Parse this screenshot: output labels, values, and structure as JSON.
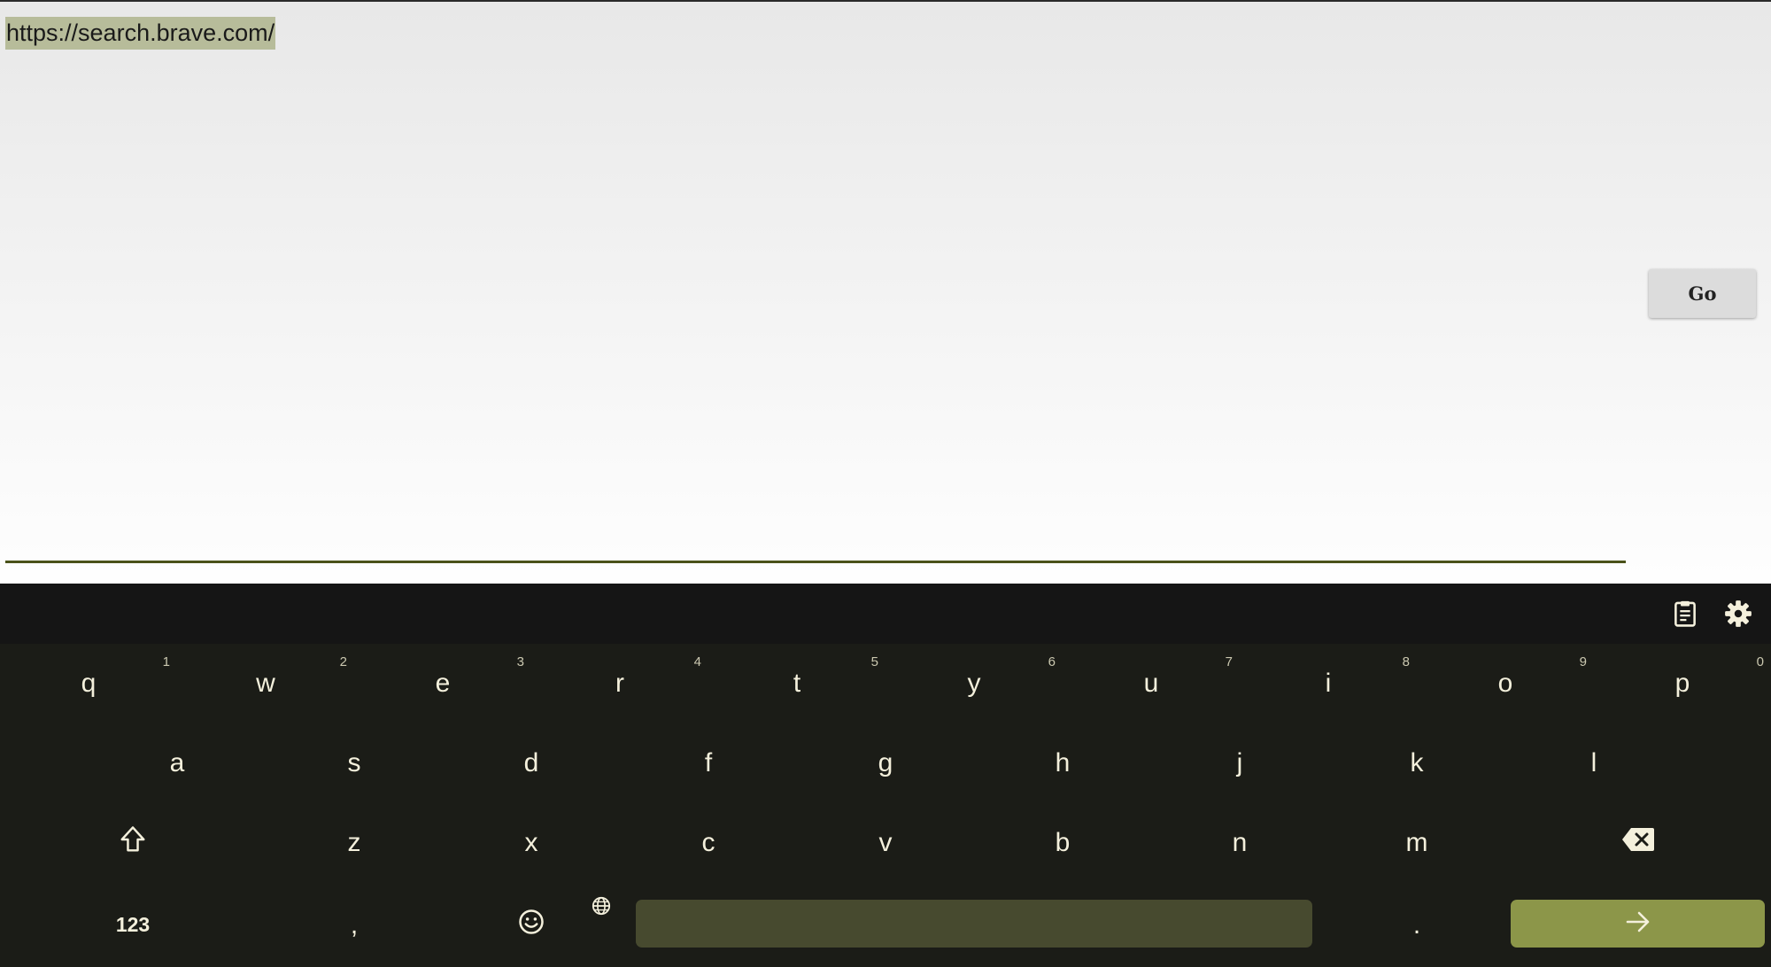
{
  "browser": {
    "url_value": "https://search.brave.com/",
    "go_label": "Go"
  },
  "keyboard": {
    "toolbar": {
      "clipboard_icon": "clipboard-icon",
      "settings_icon": "gear-icon"
    },
    "row1": [
      {
        "label": "q",
        "hint": "1"
      },
      {
        "label": "w",
        "hint": "2"
      },
      {
        "label": "e",
        "hint": "3"
      },
      {
        "label": "r",
        "hint": "4"
      },
      {
        "label": "t",
        "hint": "5"
      },
      {
        "label": "y",
        "hint": "6"
      },
      {
        "label": "u",
        "hint": "7"
      },
      {
        "label": "i",
        "hint": "8"
      },
      {
        "label": "o",
        "hint": "9"
      },
      {
        "label": "p",
        "hint": "0"
      }
    ],
    "row2": [
      {
        "label": "a"
      },
      {
        "label": "s"
      },
      {
        "label": "d"
      },
      {
        "label": "f"
      },
      {
        "label": "g"
      },
      {
        "label": "h"
      },
      {
        "label": "j"
      },
      {
        "label": "k"
      },
      {
        "label": "l"
      }
    ],
    "row3": [
      {
        "label": "z"
      },
      {
        "label": "x"
      },
      {
        "label": "c"
      },
      {
        "label": "v"
      },
      {
        "label": "b"
      },
      {
        "label": "n"
      },
      {
        "label": "m"
      }
    ],
    "row4": {
      "numbers_label": "123",
      "comma_label": ",",
      "period_label": "."
    },
    "colors": {
      "background": "#1b1c17",
      "key_text": "#f4f0dc",
      "space": "#474a2f",
      "enter": "#8c9649"
    }
  }
}
